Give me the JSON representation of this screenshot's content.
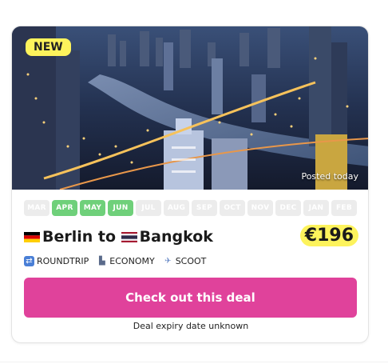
{
  "deal": {
    "badge": "NEW",
    "posted": "Posted today",
    "months": [
      {
        "label": "MAR",
        "active": false
      },
      {
        "label": "APR",
        "active": true
      },
      {
        "label": "MAY",
        "active": true
      },
      {
        "label": "JUN",
        "active": true
      },
      {
        "label": "JUL",
        "active": false
      },
      {
        "label": "AUG",
        "active": false
      },
      {
        "label": "SEP",
        "active": false
      },
      {
        "label": "OCT",
        "active": false
      },
      {
        "label": "NOV",
        "active": false
      },
      {
        "label": "DEC",
        "active": false
      },
      {
        "label": "JAN",
        "active": false
      },
      {
        "label": "FEB",
        "active": false
      }
    ],
    "origin": "Berlin",
    "route_joiner": " to ",
    "destination": "Bangkok",
    "price": "€196",
    "features": [
      {
        "label": "ROUNDTRIP",
        "icon": "roundtrip-icon"
      },
      {
        "label": "ECONOMY",
        "icon": "seat-icon"
      },
      {
        "label": "SCOOT",
        "icon": "airplane-icon"
      }
    ],
    "cta_label": "Check out this deal",
    "expiry": "Deal expiry date unknown"
  },
  "colors": {
    "accent": "#e0429b",
    "highlight": "#fdf35c",
    "month_active": "#6fd07a",
    "month_inactive": "#ececec"
  }
}
